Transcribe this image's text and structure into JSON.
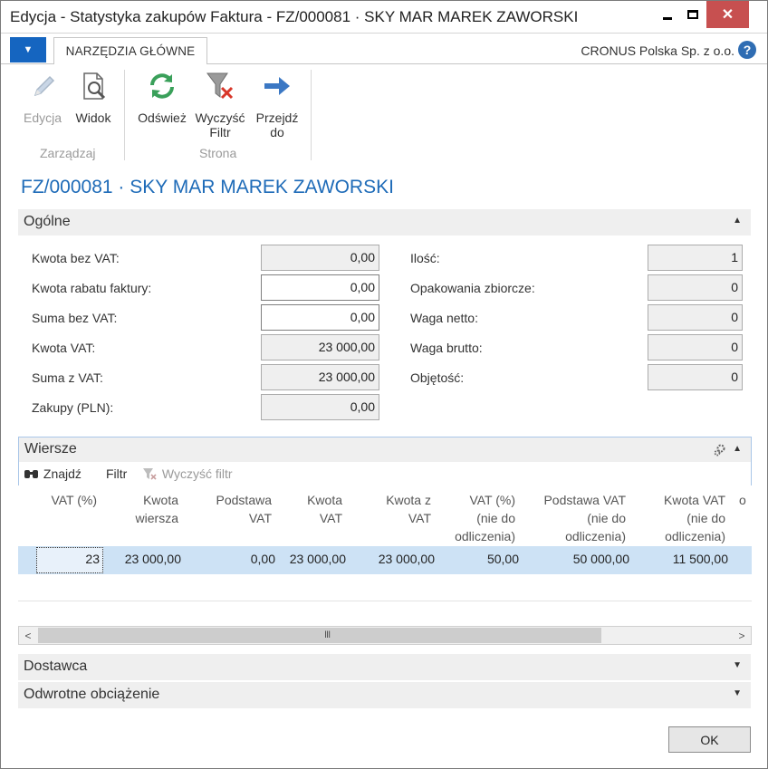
{
  "window": {
    "title": "Edycja - Statystyka zakupów Faktura - FZ/000081 · SKY MAR MAREK ZAWORSKI",
    "close_glyph": "✕"
  },
  "ribbon": {
    "menu_glyph": "▼",
    "tab_label": "NARZĘDZIA GŁÓWNE",
    "company": "CRONUS Polska Sp. z o.o.",
    "help_glyph": "?",
    "buttons": {
      "edit": "Edycja",
      "view": "Widok",
      "refresh": "Odśwież",
      "clear_filter_l1": "Wyczyść",
      "clear_filter_l2": "Filtr",
      "goto_l1": "Przejdź",
      "goto_l2": "do"
    },
    "groups": {
      "manage": "Zarządzaj",
      "page": "Strona"
    }
  },
  "record_title": "FZ/000081 · SKY MAR MAREK ZAWORSKI",
  "general": {
    "title": "Ogólne",
    "fields": [
      {
        "label": "Kwota bez VAT:",
        "value": "0,00"
      },
      {
        "label": "Kwota rabatu faktury:",
        "value": "0,00"
      },
      {
        "label": "Suma bez VAT:",
        "value": "0,00"
      },
      {
        "label": "Kwota VAT:",
        "value": "23 000,00"
      },
      {
        "label": "Suma z VAT:",
        "value": "23 000,00"
      },
      {
        "label": "Zakupy (PLN):",
        "value": "0,00"
      }
    ],
    "right_fields": [
      {
        "label": "Ilość:",
        "value": "1"
      },
      {
        "label": "Opakowania zbiorcze:",
        "value": "0"
      },
      {
        "label": "Waga netto:",
        "value": "0"
      },
      {
        "label": "Waga brutto:",
        "value": "0"
      },
      {
        "label": "Objętość:",
        "value": "0"
      }
    ]
  },
  "lines": {
    "title": "Wiersze",
    "toolbar": {
      "find": "Znajdź",
      "filter": "Filtr",
      "clear_filter": "Wyczyść filtr"
    },
    "columns": [
      {
        "l1": "VAT (%)",
        "l2": "",
        "l3": ""
      },
      {
        "l1": "Kwota",
        "l2": "wiersza",
        "l3": ""
      },
      {
        "l1": "Podstawa",
        "l2": "VAT",
        "l3": ""
      },
      {
        "l1": "Kwota",
        "l2": "VAT",
        "l3": ""
      },
      {
        "l1": "Kwota z",
        "l2": "VAT",
        "l3": ""
      },
      {
        "l1": "VAT (%)",
        "l2": "(nie do",
        "l3": "odliczenia)"
      },
      {
        "l1": "Podstawa VAT",
        "l2": "(nie do",
        "l3": "odliczenia)"
      },
      {
        "l1": "Kwota VAT",
        "l2": "(nie do",
        "l3": "odliczenia)"
      },
      {
        "l1": "",
        "l2": "o",
        "l3": ""
      }
    ],
    "rows": [
      [
        "23",
        "23 000,00",
        "0,00",
        "23 000,00",
        "23 000,00",
        "50,00",
        "50 000,00",
        "11 500,00"
      ]
    ],
    "scroll_left": "<",
    "scroll_right": ">",
    "scroll_grip": "III"
  },
  "vendor": {
    "title": "Dostawca"
  },
  "reverse_charge": {
    "title": "Odwrotne obciążenie"
  },
  "ok_label": "OK"
}
